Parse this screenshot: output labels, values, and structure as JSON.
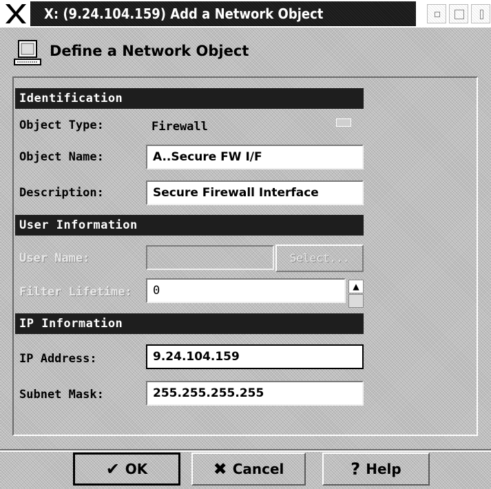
{
  "window": {
    "title": "X: (9.24.104.159) Add a Network Object",
    "close_icon": "x-logo-icon"
  },
  "header": {
    "title": "Define a Network Object",
    "icon": "computer-icon"
  },
  "identification": {
    "heading": "Identification",
    "object_type_label": "Object Type:",
    "object_type_value": "Firewall",
    "object_name_label": "Object Name:",
    "object_name_value": "A..Secure FW I/F",
    "description_label": "Description:",
    "description_value": "Secure Firewall Interface"
  },
  "user_information": {
    "heading": "User Information",
    "user_name_label": "User Name:",
    "user_name_value": "",
    "select_label": "Select...",
    "filter_lifetime_label": "Filter Lifetime:",
    "filter_lifetime_value": "0"
  },
  "ip_information": {
    "heading": "IP Information",
    "ip_address_label": "IP Address:",
    "ip_address_value": "9.24.104.159",
    "subnet_mask_label": "Subnet Mask:",
    "subnet_mask_value": "255.255.255.255"
  },
  "buttons": {
    "ok_label": "OK",
    "cancel_label": "Cancel",
    "help_label": "Help"
  }
}
